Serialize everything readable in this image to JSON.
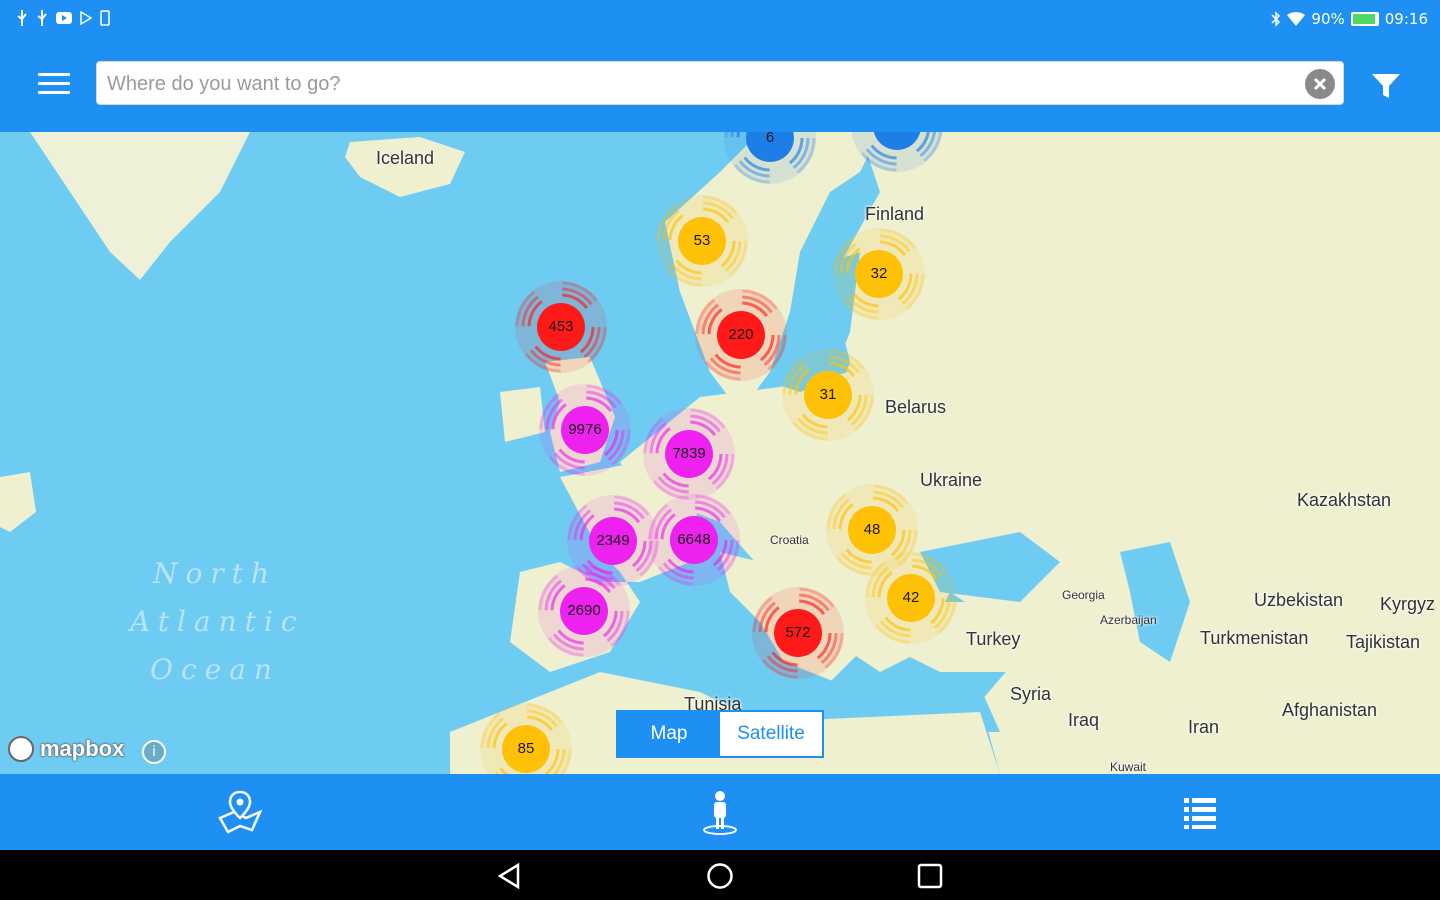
{
  "status_bar": {
    "battery": "90%",
    "time": "09:16",
    "battery_level": 0.9
  },
  "search": {
    "placeholder": "Where do you want to go?",
    "value": ""
  },
  "map": {
    "countries": [
      {
        "name": "Iceland",
        "size": "normal"
      },
      {
        "name": "Finland",
        "size": "normal"
      },
      {
        "name": "Belarus",
        "size": "normal"
      },
      {
        "name": "Ukraine",
        "size": "normal"
      },
      {
        "name": "Kazakhstan",
        "size": "normal"
      },
      {
        "name": "Croatia",
        "size": "small"
      },
      {
        "name": "Georgia",
        "size": "small"
      },
      {
        "name": "Azerbaijan",
        "size": "small"
      },
      {
        "name": "Uzbekistan",
        "size": "normal"
      },
      {
        "name": "Kyrgyz",
        "size": "normal"
      },
      {
        "name": "Turkmenistan",
        "size": "normal"
      },
      {
        "name": "Tajikistan",
        "size": "normal"
      },
      {
        "name": "Turkey",
        "size": "normal"
      },
      {
        "name": "Syria",
        "size": "normal"
      },
      {
        "name": "Iraq",
        "size": "normal"
      },
      {
        "name": "Iran",
        "size": "normal"
      },
      {
        "name": "Afghanistan",
        "size": "normal"
      },
      {
        "name": "Tunisia",
        "size": "normal"
      },
      {
        "name": "Kuwait",
        "size": "small"
      }
    ],
    "ocean_label": [
      "North",
      "Atlantic",
      "Ocean"
    ],
    "clusters": [
      {
        "count": "6",
        "color": "#1e7ee8"
      },
      {
        "count": "",
        "color": "#1e7ee8"
      },
      {
        "count": "53",
        "color": "#ffc107"
      },
      {
        "count": "32",
        "color": "#ffc107"
      },
      {
        "count": "453",
        "color": "#ff1a1a"
      },
      {
        "count": "220",
        "color": "#ff1a1a"
      },
      {
        "count": "31",
        "color": "#ffc107"
      },
      {
        "count": "9976",
        "color": "#ee22ee"
      },
      {
        "count": "7839",
        "color": "#ee22ee"
      },
      {
        "count": "48",
        "color": "#ffc107"
      },
      {
        "count": "2349",
        "color": "#ee22ee"
      },
      {
        "count": "6648",
        "color": "#ee22ee"
      },
      {
        "count": "42",
        "color": "#ffc107"
      },
      {
        "count": "2690",
        "color": "#ee22ee"
      },
      {
        "count": "572",
        "color": "#ff1a1a"
      },
      {
        "count": "85",
        "color": "#ffc107"
      }
    ],
    "attribution": "mapbox",
    "info_label": "i",
    "view_toggle": {
      "map_label": "Map",
      "satellite_label": "Satellite",
      "selected": "Map"
    }
  },
  "bottom_nav": [
    {
      "icon": "map-pin-icon"
    },
    {
      "icon": "person-icon"
    },
    {
      "icon": "list-icon"
    }
  ],
  "system_nav": [
    {
      "icon": "back-icon"
    },
    {
      "icon": "home-icon"
    },
    {
      "icon": "recents-icon"
    }
  ],
  "colors": {
    "primary": "#1e90f3",
    "water": "#6ecbf2",
    "land": "#eef0d0"
  }
}
